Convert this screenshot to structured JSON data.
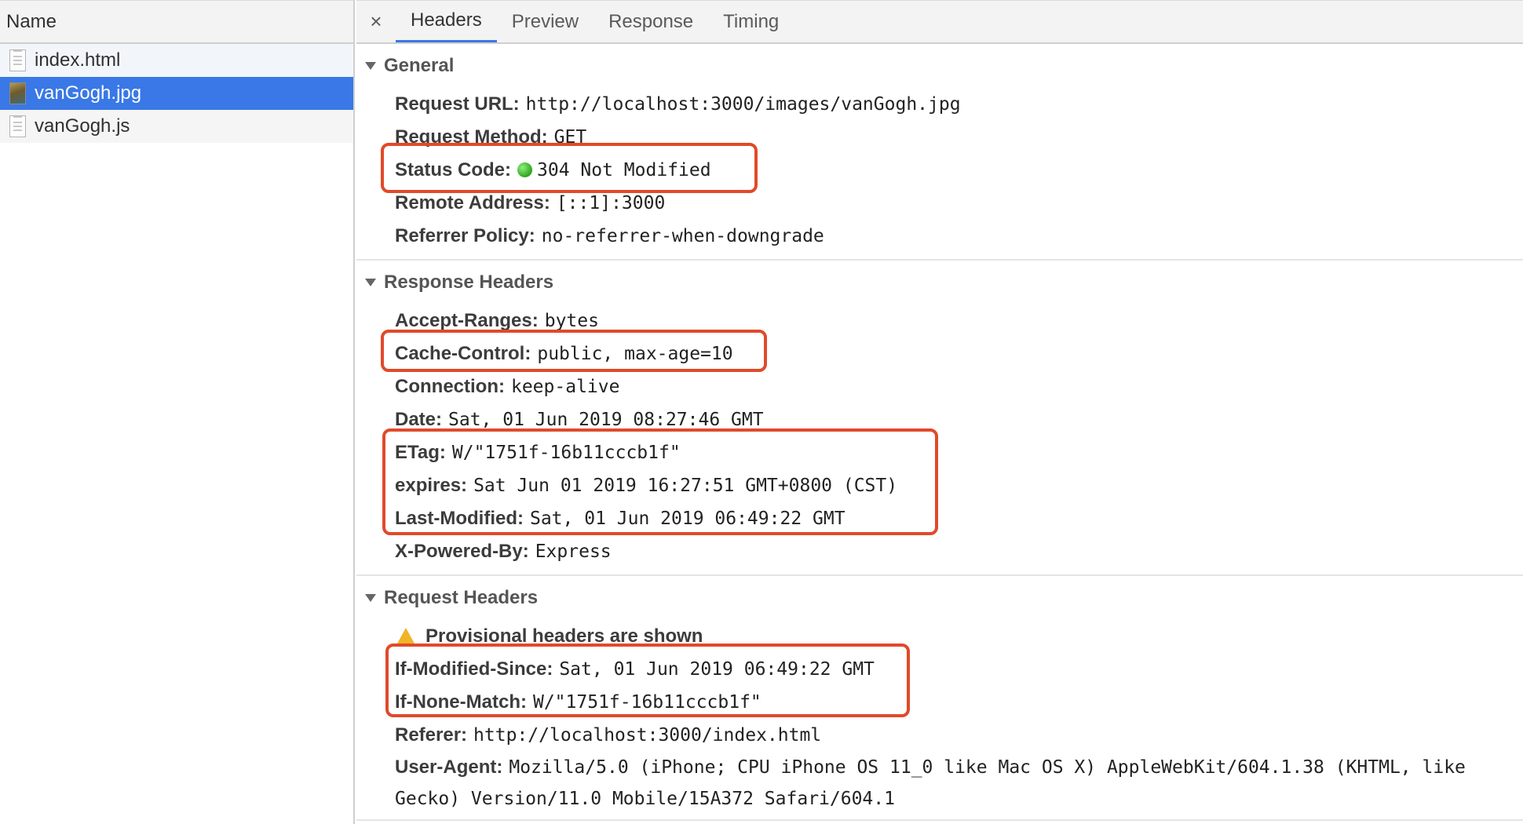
{
  "request_list": {
    "header": "Name",
    "items": [
      {
        "name": "index.html",
        "icon": "document-icon"
      },
      {
        "name": "vanGogh.jpg",
        "icon": "image-icon"
      },
      {
        "name": "vanGogh.js",
        "icon": "document-icon"
      }
    ]
  },
  "tabs": {
    "close_symbol": "×",
    "items": [
      "Headers",
      "Preview",
      "Response",
      "Timing"
    ],
    "active": "Headers"
  },
  "general": {
    "title": "General",
    "rows": [
      {
        "key": "Request URL:",
        "value": "http://localhost:3000/images/vanGogh.jpg"
      },
      {
        "key": "Request Method:",
        "value": "GET"
      },
      {
        "key": "Status Code:",
        "value": "304 Not Modified"
      },
      {
        "key": "Remote Address:",
        "value": "[::1]:3000"
      },
      {
        "key": "Referrer Policy:",
        "value": "no-referrer-when-downgrade"
      }
    ]
  },
  "response_headers": {
    "title": "Response Headers",
    "rows": [
      {
        "key": "Accept-Ranges:",
        "value": "bytes"
      },
      {
        "key": "Cache-Control:",
        "value": "public, max-age=10"
      },
      {
        "key": "Connection:",
        "value": "keep-alive"
      },
      {
        "key": "Date:",
        "value": "Sat, 01 Jun 2019 08:27:46 GMT"
      },
      {
        "key": "ETag:",
        "value": "W/\"1751f-16b11cccb1f\""
      },
      {
        "key": "expires:",
        "value": "Sat Jun 01 2019 16:27:51 GMT+0800 (CST)"
      },
      {
        "key": "Last-Modified:",
        "value": "Sat, 01 Jun 2019 06:49:22 GMT"
      },
      {
        "key": "X-Powered-By:",
        "value": "Express"
      }
    ]
  },
  "request_headers": {
    "title": "Request Headers",
    "provisional_notice": "Provisional headers are shown",
    "rows": [
      {
        "key": "If-Modified-Since:",
        "value": "Sat, 01 Jun 2019 06:49:22 GMT"
      },
      {
        "key": "If-None-Match:",
        "value": "W/\"1751f-16b11cccb1f\""
      },
      {
        "key": "Referer:",
        "value": "http://localhost:3000/index.html"
      },
      {
        "key": "User-Agent:",
        "value": "Mozilla/5.0 (iPhone; CPU iPhone OS 11_0 like Mac OS X) AppleWebKit/604.1.38 (KHTML, like Gecko) Version/11.0 Mobile/15A372 Safari/604.1"
      }
    ]
  },
  "colors": {
    "selection": "#3978e6",
    "highlight_box": "#e04a2a",
    "status_dot": "#2fa41f",
    "warning": "#f0b429"
  }
}
